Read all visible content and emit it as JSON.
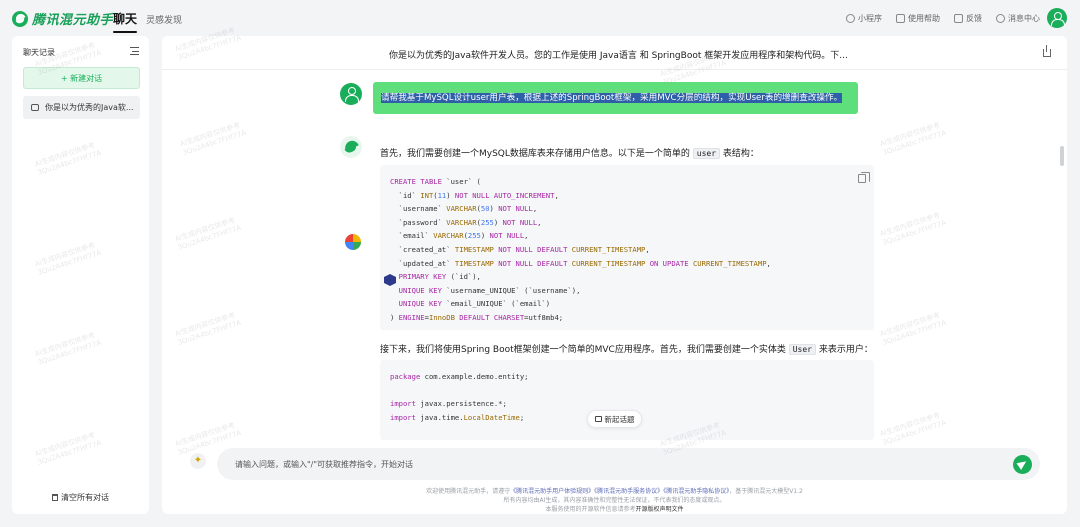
{
  "topbar": {
    "logo_text": "腾讯混元助手",
    "nav_chat": "聊天",
    "nav_inspire": "灵感发现",
    "links": [
      "小程序",
      "使用帮助",
      "反馈",
      "消息中心"
    ]
  },
  "sidebar": {
    "title": "聊天记录",
    "new_chat": "+ 新建对话",
    "history": [
      "你是以为优秀的Java软..."
    ],
    "clear_all": "清空所有对话"
  },
  "main": {
    "header_title": "你是以为优秀的Java软件开发人员。您的工作是使用 Java语言 和 SpringBoot 框架开发应用程序和架构代码。下...",
    "user_message": "请帮我基于MySQL设计user用户表，根据上述的SpringBoot框架，采用MVC分层的结构，实现User表的增删查改操作。",
    "reply_intro_1": "首先，我们需要创建一个MySQL数据库表来存储用户信息。以下是一个简单的",
    "reply_intro_1_chip": "user",
    "reply_intro_1_end": "表结构：",
    "reply_intro_2": "接下来，我们将使用Spring Boot框架创建一个简单的MVC应用程序。首先，我们需要创建一个实体类",
    "reply_intro_2_chip": "User",
    "reply_intro_2_end": "来表示用户：",
    "new_topic": "新起话题",
    "input_placeholder": "请输入问题，或输入\"/\"可获取推荐指令，开始对话"
  },
  "code_sql": [
    "CREATE TABLE `user` (",
    "  `id` INT(11) NOT NULL AUTO_INCREMENT,",
    "  `username` VARCHAR(50) NOT NULL,",
    "  `password` VARCHAR(255) NOT NULL,",
    "  `email` VARCHAR(255) NOT NULL,",
    "  `created_at` TIMESTAMP NOT NULL DEFAULT CURRENT_TIMESTAMP,",
    "  `updated_at` TIMESTAMP NOT NULL DEFAULT CURRENT_TIMESTAMP ON UPDATE CURRENT_TIMESTAMP,",
    "  PRIMARY KEY (`id`),",
    "  UNIQUE KEY `username_UNIQUE` (`username`),",
    "  UNIQUE KEY `email_UNIQUE` (`email`)",
    ") ENGINE=InnoDB DEFAULT CHARSET=utf8mb4;"
  ],
  "code_java": [
    "package com.example.demo.entity;",
    "",
    "import javax.persistence.*;",
    "import java.time.LocalDateTime;"
  ],
  "footer": {
    "line1_prefix": "欢迎使用腾讯混元助手，请遵守",
    "link1": "《腾讯混元助手用户体验规则》",
    "link2": "《腾讯混元助手服务协议》",
    "link3": "《腾讯混元助手隐私协议》",
    "line1_suffix": "，基于腾讯混元大模型V1.2",
    "line2": "所有内容均由AI生成，其内容准确性和完整性无法保证，不代表我们的态度或观点。",
    "line3_prefix": "本服务使用的开源软件信息请参考",
    "line3_link": "开源版权声明文件"
  },
  "watermark": [
    "AI生成内容仅供参考",
    "3Qu2A4bc7FHf77A"
  ],
  "colors": {
    "brand_green": "#1aae5b",
    "user_bubble": "#5fdf7b",
    "selection": "#2e5fa8"
  }
}
